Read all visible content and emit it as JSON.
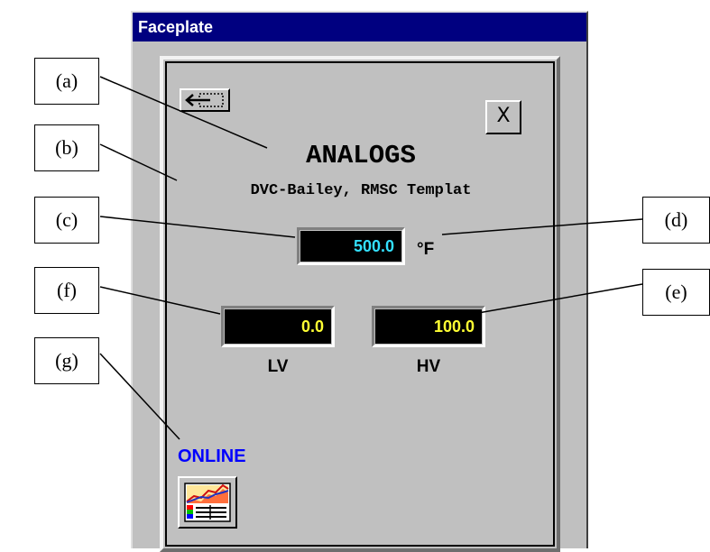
{
  "window": {
    "title": "Faceplate"
  },
  "faceplate": {
    "back_icon": "back-arrow-icon",
    "close_label": "X",
    "heading": "ANALOGS",
    "subheading": "DVC-Bailey, RMSC Templat",
    "process_value": "500.0",
    "unit": "°F",
    "low_value": "0.0",
    "high_value": "100.0",
    "low_label": "LV",
    "high_label": "HV",
    "status": "ONLINE",
    "trend_icon": "trend-chart-icon"
  },
  "callouts": {
    "a": "(a)",
    "b": "(b)",
    "c": "(c)",
    "d": "(d)",
    "e": "(e)",
    "f": "(f)",
    "g": "(g)"
  },
  "colors": {
    "titlebar": "#000080",
    "panel": "#c0c0c0",
    "process_value_text": "#33e0ff",
    "limit_value_text": "#ffff33",
    "status_text": "#0000ff"
  }
}
